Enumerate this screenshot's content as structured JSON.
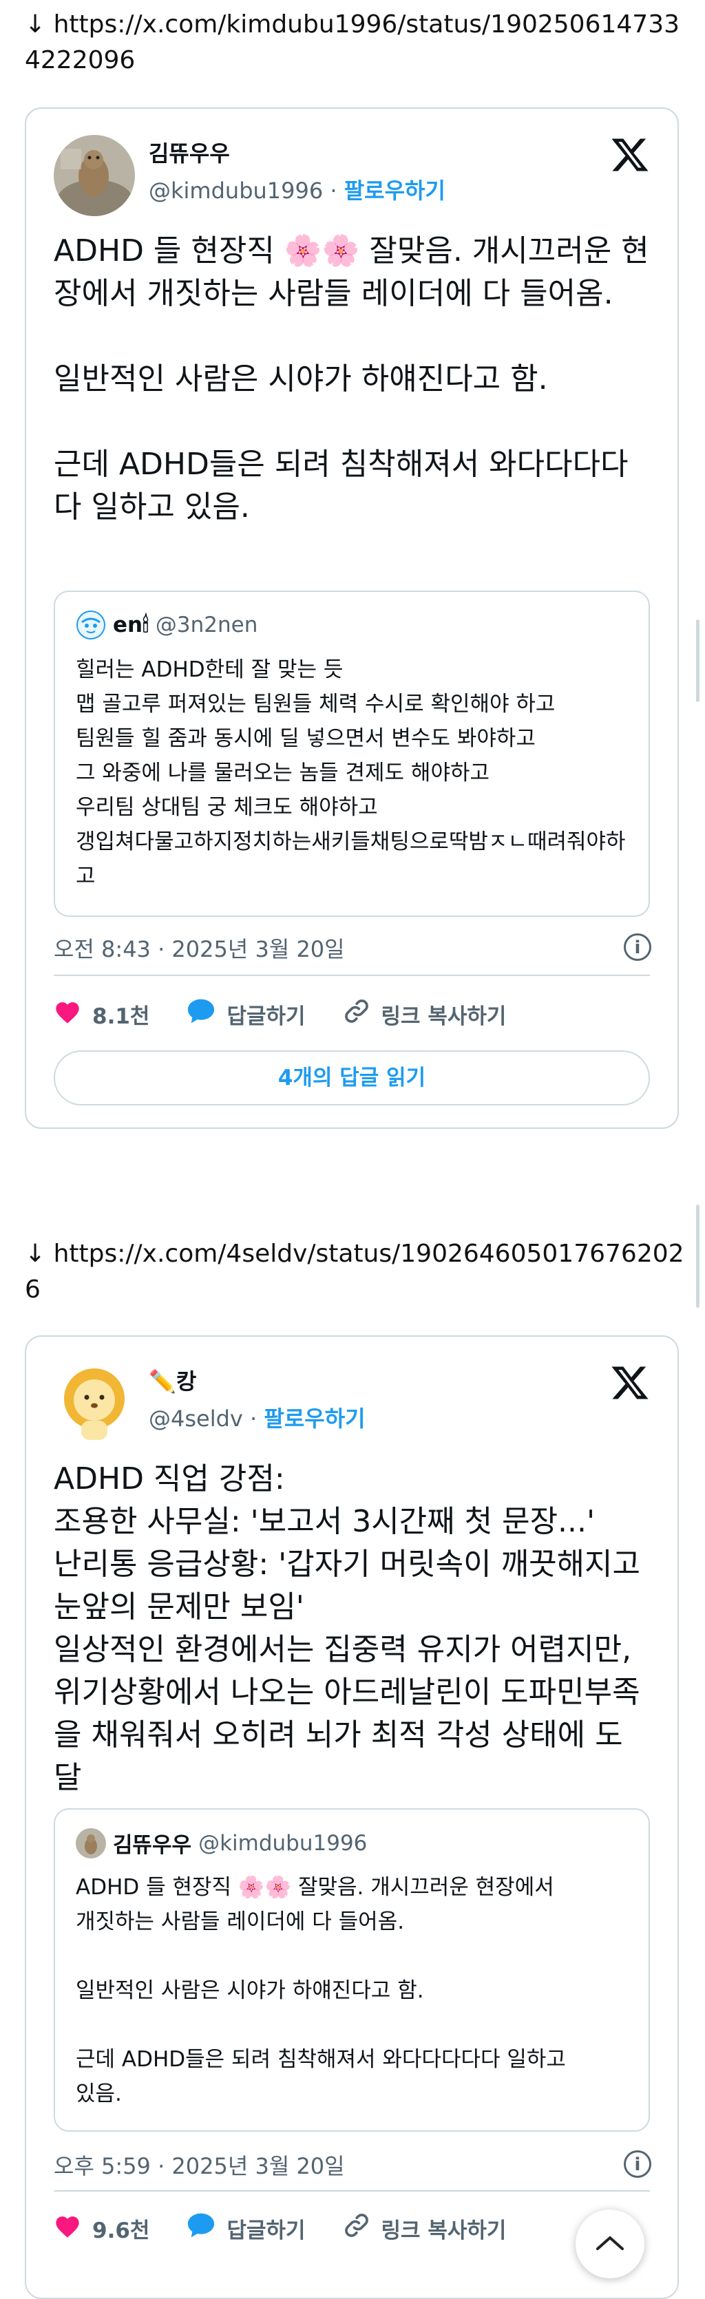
{
  "posts": [
    {
      "url": "↓ https://x.com/kimdubu1996/status/1902506147334222096",
      "author_name": "김뜌우우",
      "author_handle": "@kimdubu1996",
      "follow_label": "팔로우하기",
      "text": "ADHD 들 현장직 🌸🌸 잘맞음. 개시끄러운 현장에서 개짓하는 사람들 레이더에 다 들어옴.\n\n일반적인 사람은 시야가 하얘진다고 함.\n\n근데 ADHD들은 되려 침착해져서 와다다다다다 일하고 있음.",
      "quote": {
        "name": "en🕯",
        "handle": "@3n2nen",
        "text": "힐러는 ADHD한테 잘 맞는 듯\n맵 골고루 퍼져있는 팀원들 체력 수시로 확인해야 하고\n팀원들 힐 줌과 동시에 딜 넣으면서 변수도 봐야하고\n그 와중에 나를 물러오는 놈들 견제도 해야하고\n우리팀 상대팀 궁 체크도 해야하고\n갱입쳐다물고하지정치하는새키들채팅으로딱밤ㅈㄴ때려줘야하고"
      },
      "timestamp": "오전 8:43 · 2025년 3월 20일",
      "likes": "8.1천",
      "reply_label": "답글하기",
      "copy_link_label": "링크 복사하기",
      "read_replies_label": "4개의 답글 읽기"
    },
    {
      "url": "↓ https://x.com/4seldv/status/1902646050176762026",
      "author_name": "✏️캉",
      "author_handle": "@4seldv",
      "follow_label": "팔로우하기",
      "text": "ADHD 직업 강점:\n조용한 사무실: '보고서 3시간째 첫 문장...'\n난리통 응급상황: '갑자기 머릿속이 깨끗해지고 눈앞의 문제만 보임'\n일상적인 환경에서는 집중력 유지가 어렵지만, 위기상황에서 나오는 아드레날린이 도파민부족을 채워줘서 오히려 뇌가 최적 각성 상태에 도달",
      "quote": {
        "name": "김뜌우우",
        "handle": "@kimdubu1996",
        "text": "ADHD 들 현장직 🌸🌸 잘맞음. 개시끄러운 현장에서\n개짓하는 사람들 레이더에 다 들어옴.\n\n일반적인 사람은 시야가 하얘진다고 함.\n\n근데 ADHD들은 되려 침착해져서 와다다다다다 일하고\n있음."
      },
      "timestamp": "오후 5:59 · 2025년 3월 20일",
      "likes": "9.6천",
      "reply_label": "답글하기",
      "copy_link_label": "링크 복사하기"
    }
  ],
  "icons": {
    "like": "heart-icon",
    "reply": "speech-bubble-icon",
    "link": "link-icon",
    "info": "info-icon",
    "x": "x-logo-icon",
    "scroll_top": "chevron-up-icon"
  },
  "colors": {
    "accent": "#1d9bf0",
    "like": "#f91880",
    "muted": "#536471",
    "border": "#cfd9de"
  }
}
